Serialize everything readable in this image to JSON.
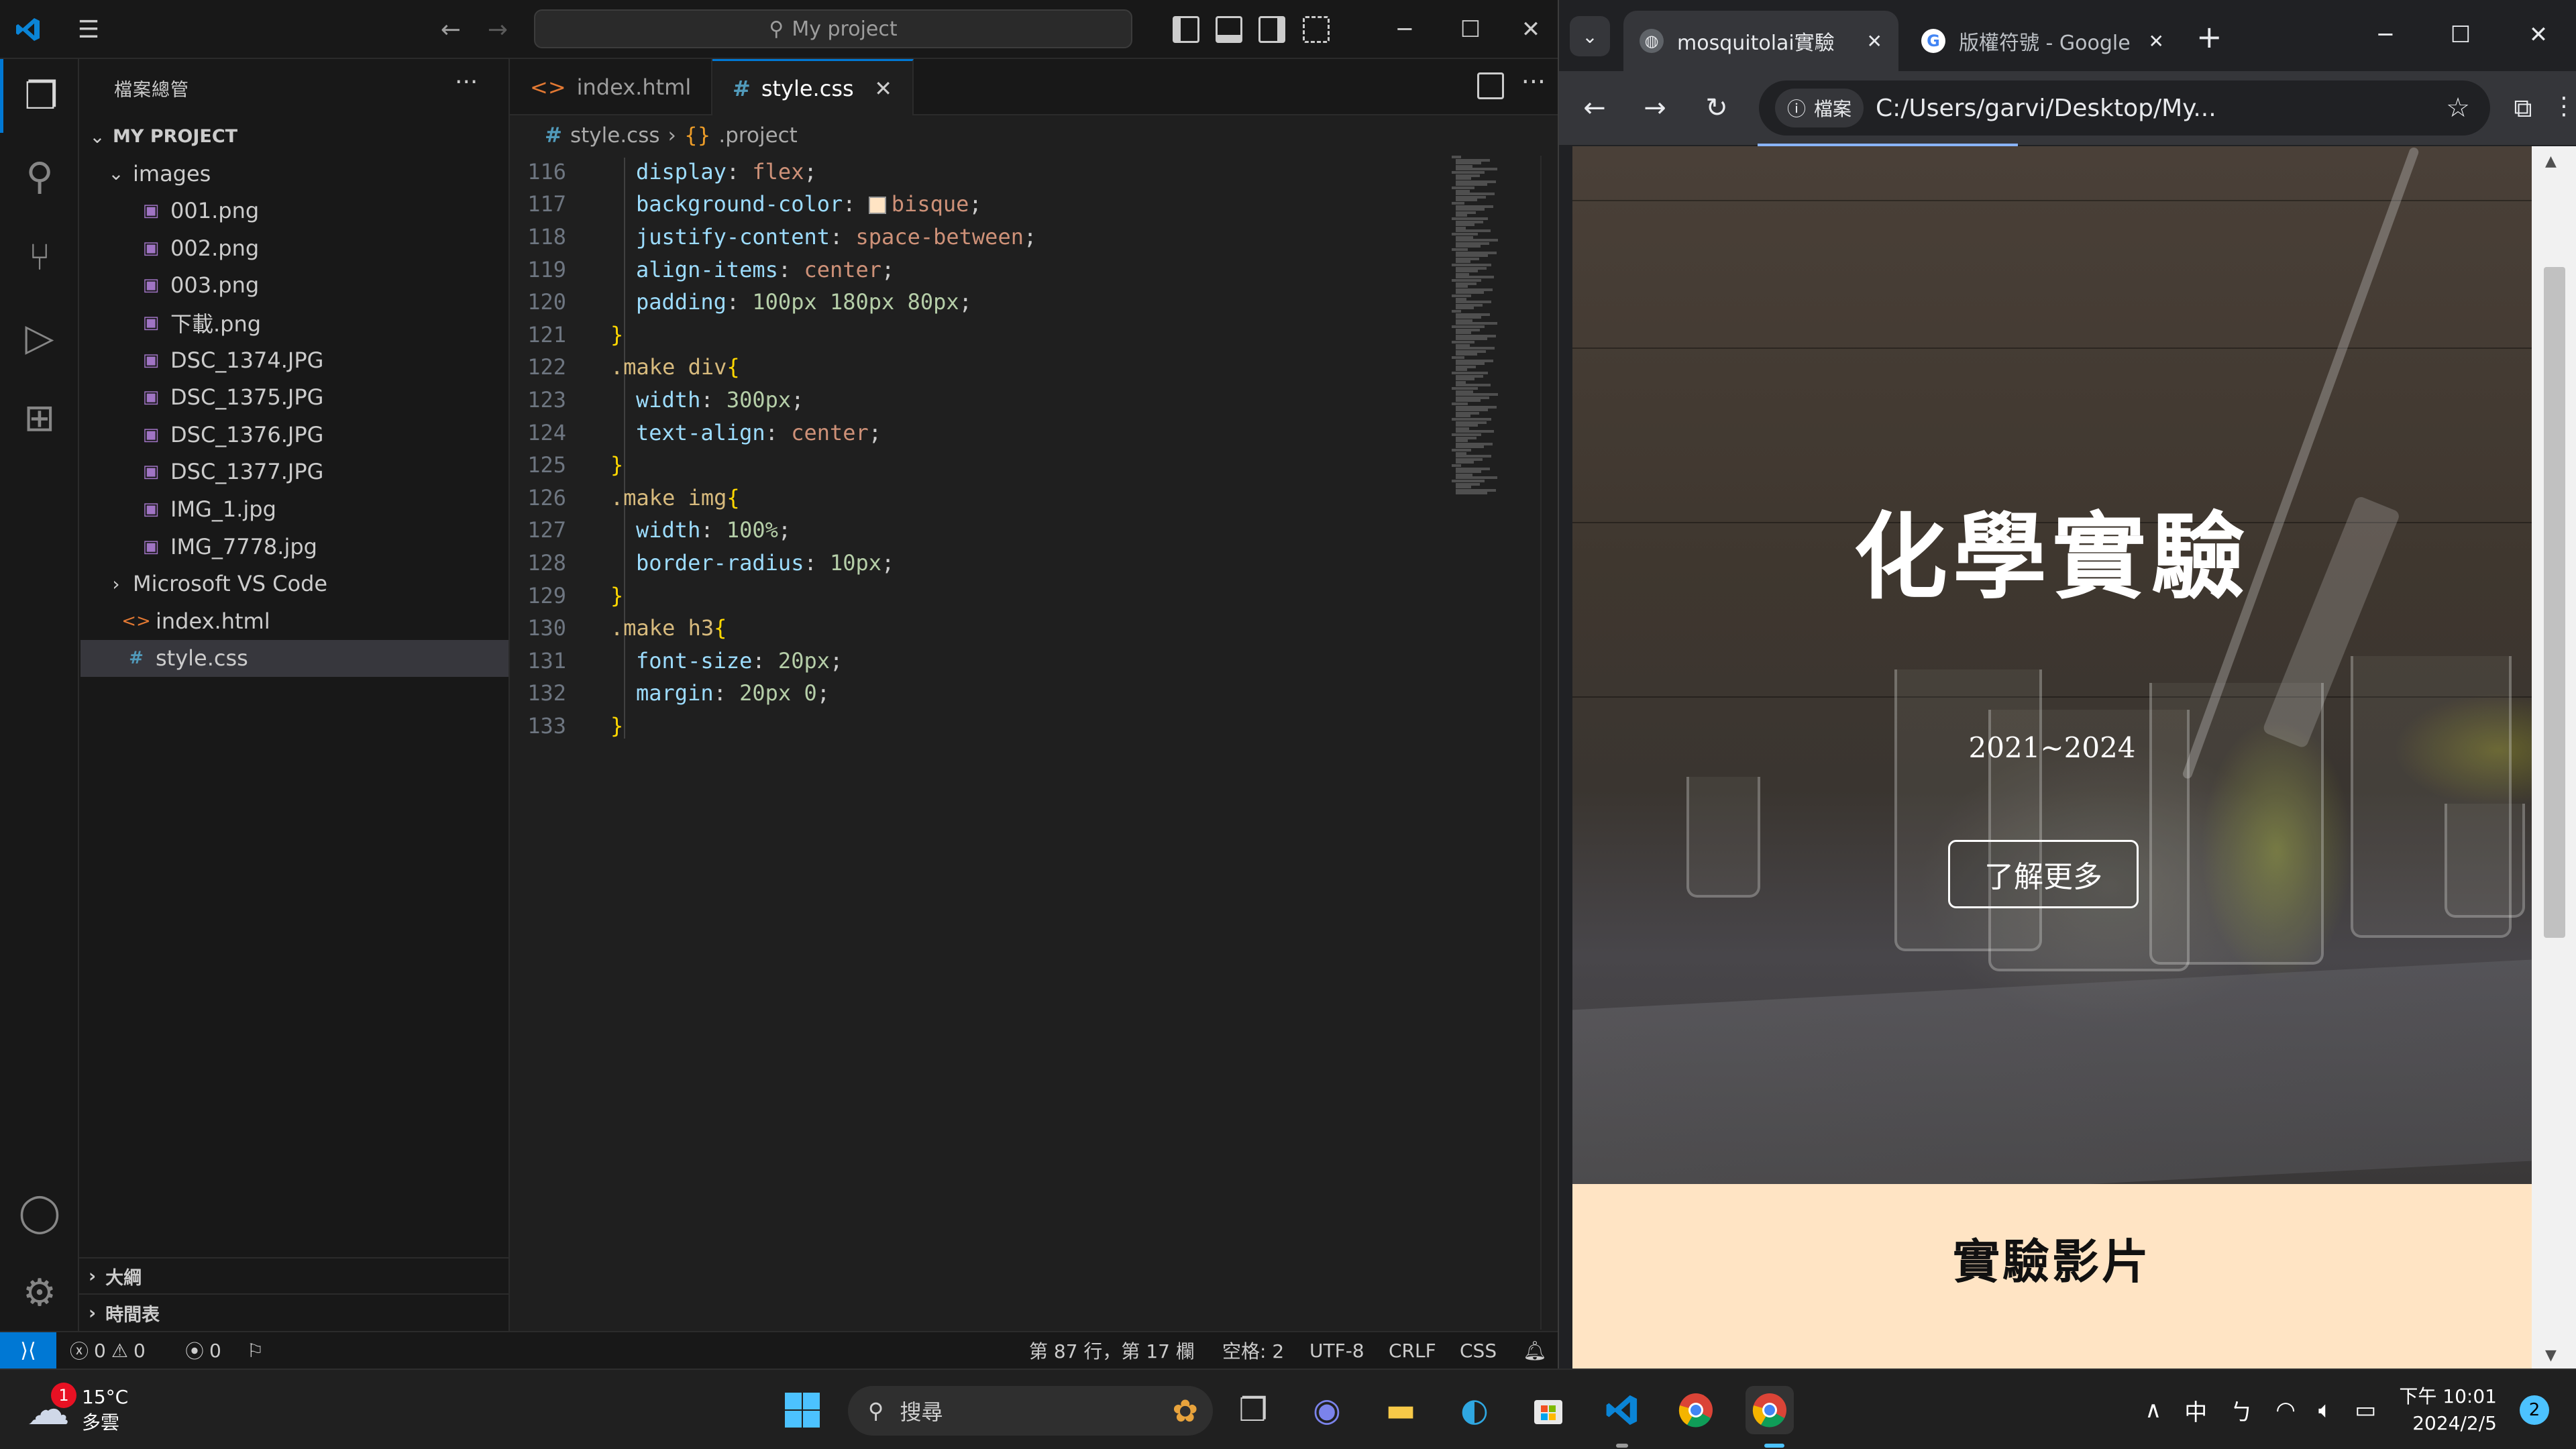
{
  "vscode": {
    "command_center": "My project",
    "explorer_title": "檔案總管",
    "project": "MY PROJECT",
    "tree": [
      {
        "label": "images",
        "kind": "folder-open",
        "indent": 1
      },
      {
        "label": "001.png",
        "kind": "image",
        "indent": 2
      },
      {
        "label": "002.png",
        "kind": "image",
        "indent": 2
      },
      {
        "label": "003.png",
        "kind": "image",
        "indent": 2
      },
      {
        "label": "下載.png",
        "kind": "image",
        "indent": 2
      },
      {
        "label": "DSC_1374.JPG",
        "kind": "image",
        "indent": 2
      },
      {
        "label": "DSC_1375.JPG",
        "kind": "image",
        "indent": 2
      },
      {
        "label": "DSC_1376.JPG",
        "kind": "image",
        "indent": 2
      },
      {
        "label": "DSC_1377.JPG",
        "kind": "image",
        "indent": 2
      },
      {
        "label": "IMG_1.jpg",
        "kind": "image",
        "indent": 2
      },
      {
        "label": "IMG_7778.jpg",
        "kind": "image",
        "indent": 2
      },
      {
        "label": "Microsoft VS Code",
        "kind": "folder-closed",
        "indent": 1
      },
      {
        "label": "index.html",
        "kind": "html",
        "indent": 1
      },
      {
        "label": "style.css",
        "kind": "css",
        "indent": 1,
        "selected": true
      }
    ],
    "outline_label": "大綱",
    "timeline_label": "時間表",
    "tabs": [
      {
        "label": "index.html",
        "active": false
      },
      {
        "label": "style.css",
        "active": true
      }
    ],
    "breadcrumb": {
      "file": "style.css",
      "symbol": ".project"
    },
    "code_lines": [
      {
        "n": "116",
        "indent": 1,
        "tokens": [
          [
            "prop",
            "display"
          ],
          [
            "punc",
            ": "
          ],
          [
            "val",
            "flex"
          ],
          [
            "punc",
            ";"
          ]
        ]
      },
      {
        "n": "117",
        "indent": 1,
        "tokens": [
          [
            "prop",
            "background-color"
          ],
          [
            "punc",
            ": "
          ],
          [
            "swatch",
            ""
          ],
          [
            "val",
            "bisque"
          ],
          [
            "punc",
            ";"
          ]
        ]
      },
      {
        "n": "118",
        "indent": 1,
        "tokens": [
          [
            "prop",
            "justify-content"
          ],
          [
            "punc",
            ": "
          ],
          [
            "val",
            "space-between"
          ],
          [
            "punc",
            ";"
          ]
        ]
      },
      {
        "n": "119",
        "indent": 1,
        "tokens": [
          [
            "prop",
            "align-items"
          ],
          [
            "punc",
            ": "
          ],
          [
            "val",
            "center"
          ],
          [
            "punc",
            ";"
          ]
        ]
      },
      {
        "n": "120",
        "indent": 1,
        "tokens": [
          [
            "prop",
            "padding"
          ],
          [
            "punc",
            ": "
          ],
          [
            "num",
            "100px 180px 80px"
          ],
          [
            "punc",
            ";"
          ]
        ]
      },
      {
        "n": "121",
        "indent": 0,
        "tokens": [
          [
            "brace",
            "}"
          ]
        ]
      },
      {
        "n": "122",
        "indent": 0,
        "tokens": [
          [
            "sel",
            ".make div"
          ],
          [
            "brace",
            "{"
          ]
        ]
      },
      {
        "n": "123",
        "indent": 1,
        "tokens": [
          [
            "prop",
            "width"
          ],
          [
            "punc",
            ": "
          ],
          [
            "num",
            "300px"
          ],
          [
            "punc",
            ";"
          ]
        ]
      },
      {
        "n": "124",
        "indent": 1,
        "tokens": [
          [
            "prop",
            "text-align"
          ],
          [
            "punc",
            ": "
          ],
          [
            "val",
            "center"
          ],
          [
            "punc",
            ";"
          ]
        ]
      },
      {
        "n": "125",
        "indent": 0,
        "tokens": [
          [
            "brace",
            "}"
          ]
        ]
      },
      {
        "n": "126",
        "indent": 0,
        "tokens": [
          [
            "sel",
            ".make img"
          ],
          [
            "brace",
            "{"
          ]
        ]
      },
      {
        "n": "127",
        "indent": 1,
        "tokens": [
          [
            "prop",
            "width"
          ],
          [
            "punc",
            ": "
          ],
          [
            "num",
            "100%"
          ],
          [
            "punc",
            ";"
          ]
        ]
      },
      {
        "n": "128",
        "indent": 1,
        "tokens": [
          [
            "prop",
            "border-radius"
          ],
          [
            "punc",
            ": "
          ],
          [
            "num",
            "10px"
          ],
          [
            "punc",
            ";"
          ]
        ]
      },
      {
        "n": "129",
        "indent": 0,
        "tokens": [
          [
            "brace",
            "}"
          ]
        ]
      },
      {
        "n": "130",
        "indent": 0,
        "tokens": [
          [
            "sel",
            ".make h3"
          ],
          [
            "brace",
            "{"
          ]
        ]
      },
      {
        "n": "131",
        "indent": 1,
        "tokens": [
          [
            "prop",
            "font-size"
          ],
          [
            "punc",
            ": "
          ],
          [
            "num",
            "20px"
          ],
          [
            "punc",
            ";"
          ]
        ]
      },
      {
        "n": "132",
        "indent": 1,
        "tokens": [
          [
            "prop",
            "margin"
          ],
          [
            "punc",
            ": "
          ],
          [
            "num",
            "20px 0"
          ],
          [
            "punc",
            ";"
          ]
        ]
      },
      {
        "n": "133",
        "indent": 0,
        "tokens": [
          [
            "brace",
            "}"
          ]
        ]
      }
    ],
    "status": {
      "errors": "0",
      "warnings": "0",
      "ports": "0",
      "position": "第 87 行，第 17 欄",
      "spaces": "空格: 2",
      "encoding": "UTF-8",
      "eol": "CRLF",
      "language": "CSS"
    }
  },
  "chrome": {
    "tabs": [
      {
        "title": "mosquitolai實驗",
        "active": true
      },
      {
        "title": "版權符號 - Google",
        "active": false
      }
    ],
    "site_chip": "檔案",
    "url": "C:/Users/garvi/Desktop/My...",
    "page": {
      "hero_title": "化學實驗",
      "hero_years": "2021~2024",
      "hero_button": "了解更多",
      "section_title": "實驗影片"
    }
  },
  "taskbar": {
    "weather_temp": "15°C",
    "weather_desc": "多雲",
    "weather_badge": "1",
    "search_placeholder": "搜尋",
    "ime_mode": "中",
    "ime_phonetic": "ㄅ",
    "time": "下午 10:01",
    "date": "2024/2/5",
    "notifications": "2"
  }
}
